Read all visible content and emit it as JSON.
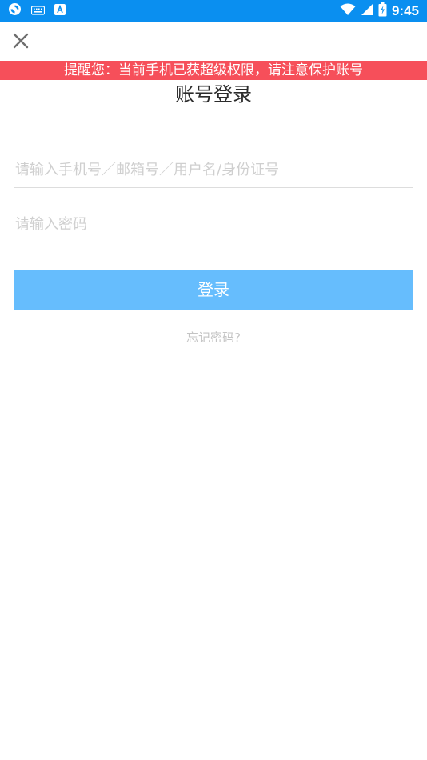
{
  "status_bar": {
    "time": "9:45",
    "left_icons": [
      "sync-icon",
      "keyboard-icon",
      "app-a-icon"
    ],
    "right_icons": [
      "wifi-icon",
      "cellular-signal-icon",
      "battery-charging-icon"
    ],
    "color": "#0a8ff0"
  },
  "header": {
    "close_icon": "close-icon"
  },
  "warning": {
    "text": "提醒您：当前手机已获超级权限，请注意保护账号",
    "color": "#f64f5a"
  },
  "login": {
    "title": "账号登录",
    "account_placeholder": "请输入手机号／邮箱号／用户名/身份证号",
    "password_placeholder": "请输入密码",
    "submit_label": "登录",
    "submit_color": "#66bdfd",
    "forgot_label": "忘记密码?"
  }
}
